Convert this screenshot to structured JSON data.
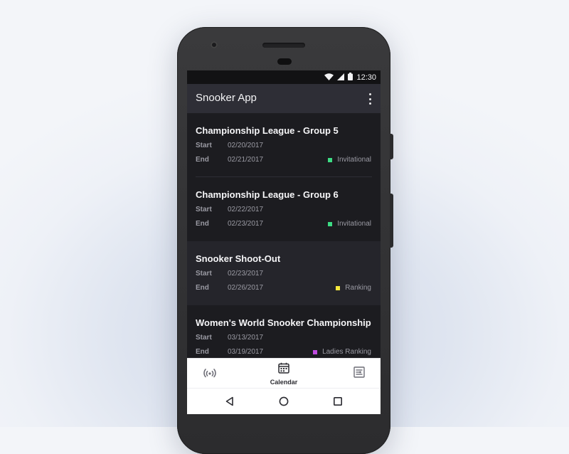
{
  "status_bar": {
    "time": "12:30",
    "icons": [
      "wifi-icon",
      "signal-icon",
      "battery-icon"
    ]
  },
  "app_bar": {
    "title": "Snooker App",
    "menu_icon": "more-vert-icon"
  },
  "labels": {
    "start": "Start",
    "end": "End"
  },
  "events": [
    {
      "title": "Championship League - Group 5",
      "start": "02/20/2017",
      "end": "02/21/2017",
      "category": "Invitational",
      "category_color": "#3ddc84",
      "highlighted": false
    },
    {
      "title": "Championship League - Group 6",
      "start": "02/22/2017",
      "end": "02/23/2017",
      "category": "Invitational",
      "category_color": "#3ddc84",
      "highlighted": false
    },
    {
      "title": "Snooker Shoot-Out",
      "start": "02/23/2017",
      "end": "02/26/2017",
      "category": "Ranking",
      "category_color": "#f5e93c",
      "highlighted": true
    },
    {
      "title": "Women's World Snooker Championship",
      "start": "03/13/2017",
      "end": "03/19/2017",
      "category": "Ladies Ranking",
      "category_color": "#c04ae0",
      "highlighted": false
    }
  ],
  "bottom_nav": [
    {
      "icon": "live-signal-icon",
      "label": ""
    },
    {
      "icon": "calendar-icon",
      "label": "Calendar",
      "active": true
    },
    {
      "icon": "rankings-icon",
      "label": ""
    }
  ],
  "system_nav": [
    "back-icon",
    "home-icon",
    "recents-icon"
  ],
  "colors": {
    "screen_bg": "#1c1c20",
    "app_bar_bg": "#2e2e36",
    "highlight_bg": "#25252b",
    "nav_bg": "#ffffff"
  }
}
